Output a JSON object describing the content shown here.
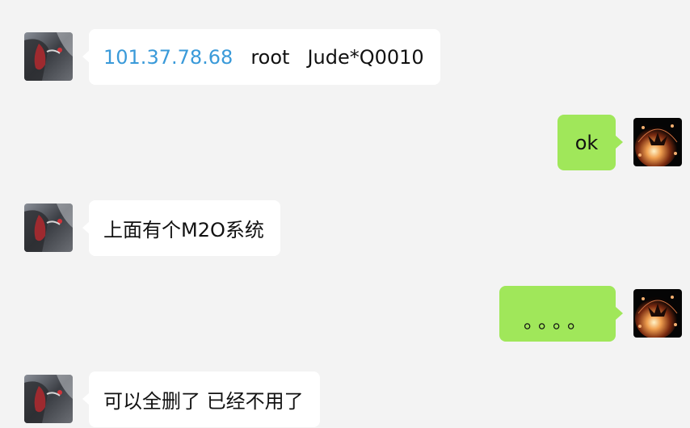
{
  "colors": {
    "background": "#f3f3f3",
    "incoming_bubble": "#ffffff",
    "outgoing_bubble": "#a0e75a",
    "link": "#3a9ad9"
  },
  "messages": [
    {
      "direction": "incoming",
      "avatar": "contact-avatar-icon",
      "parts": {
        "ip": "101.37.78.68",
        "user": "root",
        "password": "Jude*Q0010"
      }
    },
    {
      "direction": "outgoing",
      "avatar": "self-avatar-icon",
      "text": "ok"
    },
    {
      "direction": "incoming",
      "avatar": "contact-avatar-icon",
      "text": "上面有个M2O系统"
    },
    {
      "direction": "outgoing",
      "avatar": "self-avatar-icon",
      "text": "。。。。"
    },
    {
      "direction": "incoming",
      "avatar": "contact-avatar-icon",
      "text": "可以全删了 已经不用了"
    }
  ]
}
